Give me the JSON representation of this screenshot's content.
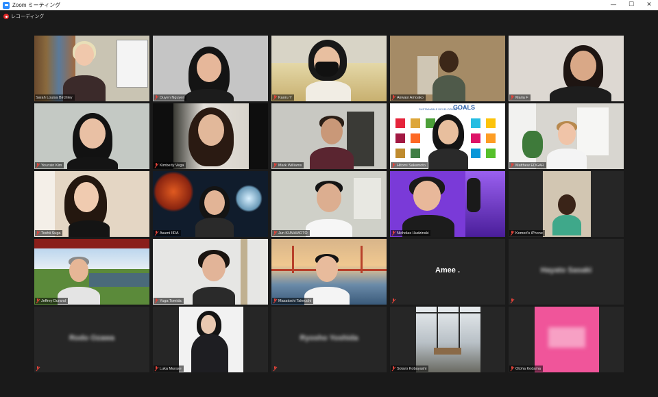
{
  "window": {
    "title": "Zoom ミーティング",
    "minimize_glyph": "—",
    "maximize_glyph": "☐",
    "close_glyph": "✕"
  },
  "recording": {
    "label": "レコーディング"
  },
  "colors": {
    "active_speaker": "#b9d40a",
    "mute": "#e5433a",
    "recording": "#e02828",
    "background": "#1a1a1a"
  },
  "participants": [
    {
      "name": "Sarah Louisa Birchley",
      "video": true,
      "active": true,
      "muted": false
    },
    {
      "name": "Duyen Nguyen",
      "video": true,
      "muted": true
    },
    {
      "name": "Kaoru Y",
      "video": true,
      "muted": true
    },
    {
      "name": "Akwasi Amoako",
      "video": true,
      "muted": true
    },
    {
      "name": "Maria F",
      "video": true,
      "muted": true
    },
    {
      "name": "Younsin Kim",
      "video": true,
      "muted": true
    },
    {
      "name": "Kimberly Vega",
      "video": true,
      "muted": true
    },
    {
      "name": "Mark Williams",
      "video": true,
      "muted": true
    },
    {
      "name": "Hitomi Sakamoto",
      "video": true,
      "muted": true
    },
    {
      "name": "Matthew EDGAR",
      "video": true,
      "muted": true
    },
    {
      "name": "Toshii Suga",
      "video": true,
      "muted": true
    },
    {
      "name": "Asumi IIDA",
      "video": true,
      "muted": true
    },
    {
      "name": "Jun KUMAMOTO",
      "video": true,
      "muted": true
    },
    {
      "name": "Nicholas Hudzinski",
      "video": true,
      "muted": true
    },
    {
      "name": "Komori's iPhone",
      "video": true,
      "muted": true
    },
    {
      "name": "Jeffrey Durand",
      "video": true,
      "muted": true
    },
    {
      "name": "Yuga Tomida",
      "video": true,
      "muted": true
    },
    {
      "name": "Masatoshi Takeuchi",
      "video": true,
      "muted": true
    },
    {
      "name": "Amee .",
      "video": false,
      "muted": true,
      "blurred": false
    },
    {
      "name": "Hayato Sasaki",
      "video": false,
      "muted": true,
      "blurred": true
    },
    {
      "name": "Rodo Ozawa",
      "video": false,
      "muted": false,
      "blurred": true
    },
    {
      "name": "Luka Murase",
      "video": true,
      "muted": true
    },
    {
      "name": "Ryosho Yoshida",
      "video": false,
      "muted": true,
      "blurred": true
    },
    {
      "name": "Sotaro Kobayashi",
      "video": true,
      "muted": true
    },
    {
      "name": "Otoha Kodama",
      "video": true,
      "muted": true
    }
  ],
  "sdg": {
    "title": "GOALS",
    "subtitle": "SUSTAINABLE DEVELOPMENT"
  }
}
